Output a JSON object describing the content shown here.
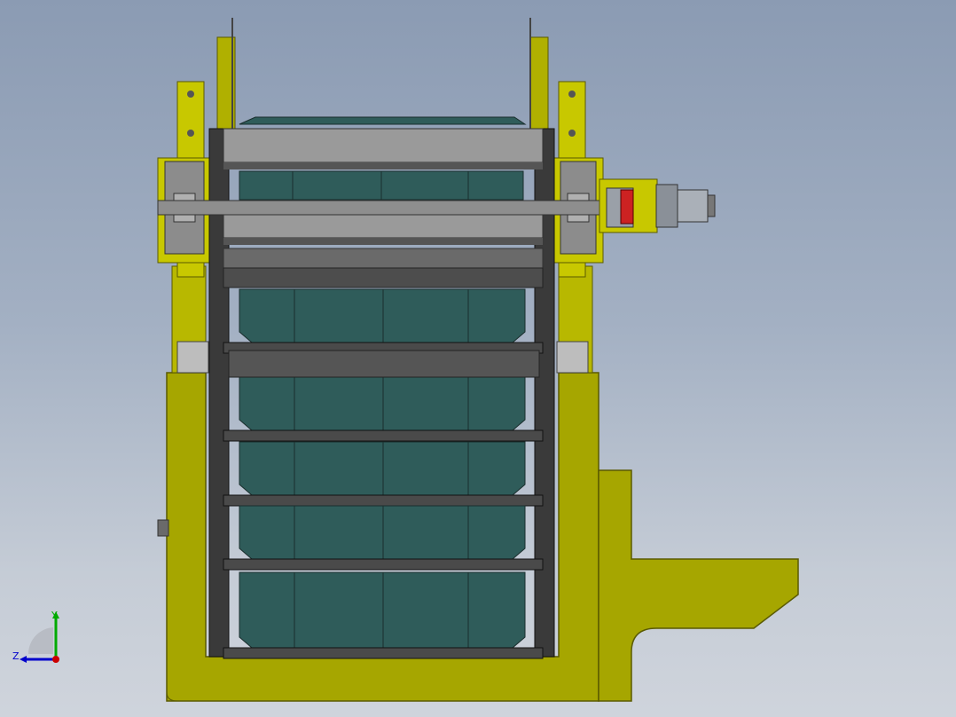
{
  "viewport": {
    "background_top": "#8b9bb3",
    "background_bottom": "#cfd4dc"
  },
  "model": {
    "frame_color": "#c8c800",
    "frame_shadow_color": "#8f8f00",
    "bucket_color": "#2f5c5a",
    "bucket_dark_color": "#1f4342",
    "chain_color": "#4a4a4a",
    "plate_color": "#8a8a8a",
    "motor_color": "#9aa0a8"
  },
  "triad": {
    "y_label": "Y",
    "z_label": "Z",
    "x_color": "#cc0000",
    "y_color": "#00aa00",
    "z_color": "#0000cc"
  }
}
